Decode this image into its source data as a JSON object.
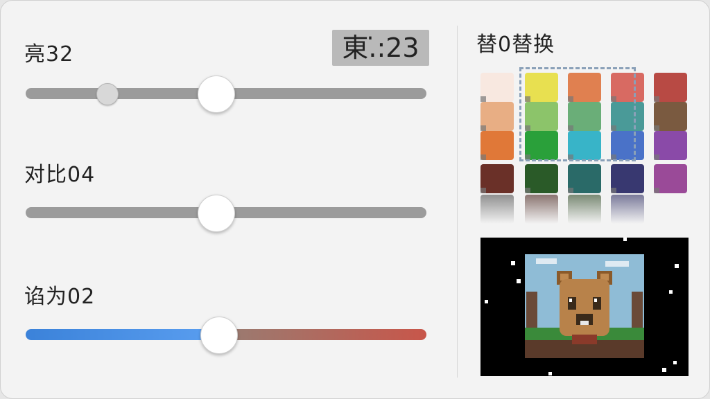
{
  "sliders": {
    "brightness_label": "亮32",
    "contrast_label": "对比04",
    "saturation_label": "谄为02",
    "badge_text": "東.̇:23"
  },
  "palette": {
    "title": "替0替换",
    "colors": [
      [
        "#f8e8e0",
        "#e8e050",
        "#e08050",
        "#d86a62",
        "#b84a44"
      ],
      [
        "#e8ae84",
        "#8cc46a",
        "#6aae78",
        "#4a9a98",
        "#7a5a40"
      ],
      [
        "#e07838",
        "#2aa03a",
        "#38b4c8",
        "#4a72c8",
        "#8a4aa8"
      ],
      [
        "#6a3028",
        "#2a5a28",
        "#2a6a68",
        "#383870",
        "#9a4a98"
      ]
    ]
  },
  "preview": {
    "icons": [
      "bear-face-icon"
    ]
  }
}
